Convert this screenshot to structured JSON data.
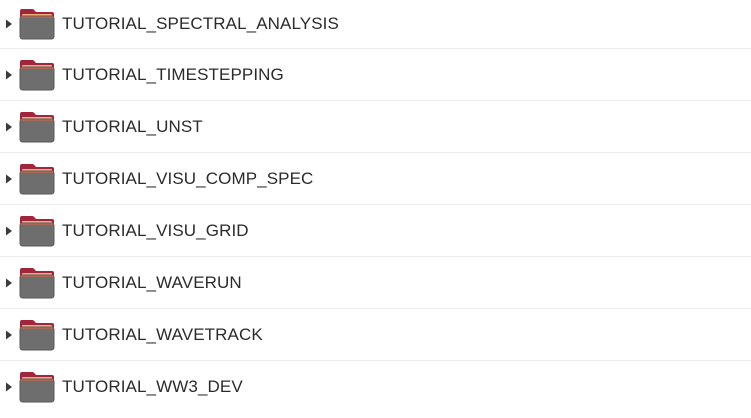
{
  "folder_colors": {
    "tab": "#a3253c",
    "tab_edge": "#c8614b",
    "paper": "#e8b07a",
    "body": "#6e6e6e",
    "body_edge": "#5a5a5a"
  },
  "tree": {
    "items": [
      {
        "label": "TUTORIAL_SPECTRAL_ANALYSIS",
        "icon": "folder-icon",
        "expander": "triangle-right-icon"
      },
      {
        "label": "TUTORIAL_TIMESTEPPING",
        "icon": "folder-icon",
        "expander": "triangle-right-icon"
      },
      {
        "label": "TUTORIAL_UNST",
        "icon": "folder-icon",
        "expander": "triangle-right-icon"
      },
      {
        "label": "TUTORIAL_VISU_COMP_SPEC",
        "icon": "folder-icon",
        "expander": "triangle-right-icon"
      },
      {
        "label": "TUTORIAL_VISU_GRID",
        "icon": "folder-icon",
        "expander": "triangle-right-icon"
      },
      {
        "label": "TUTORIAL_WAVERUN",
        "icon": "folder-icon",
        "expander": "triangle-right-icon"
      },
      {
        "label": "TUTORIAL_WAVETRACK",
        "icon": "folder-icon",
        "expander": "triangle-right-icon"
      },
      {
        "label": "TUTORIAL_WW3_DEV",
        "icon": "folder-icon",
        "expander": "triangle-right-icon"
      }
    ]
  }
}
